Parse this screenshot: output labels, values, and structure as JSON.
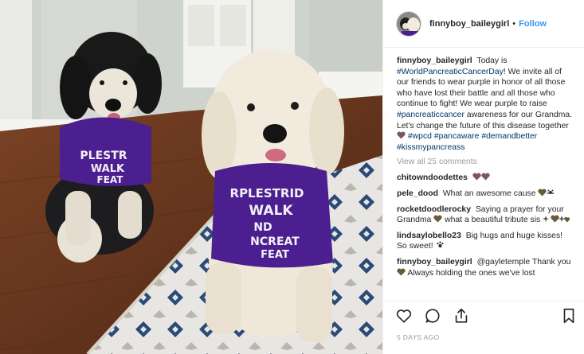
{
  "photo": {
    "description_icon": "photo-two-dogs",
    "left_shirt_lines": [
      "PLESTR",
      "WALK",
      "FEAT"
    ],
    "right_shirt_lines": [
      "RPLESTRID",
      "WALK",
      "ND",
      "NCREAT",
      "FEAT"
    ]
  },
  "header": {
    "username": "finnyboy_baileygirl",
    "separator": "•",
    "follow_label": "Follow"
  },
  "caption": {
    "username": "finnyboy_baileygirl",
    "text_1": "Today is",
    "tag_1": "#WorldPancreaticCancerDay",
    "text_2": "! We invite all of our friends to wear purple in honor of all those who have lost their battle and all those who continue to fight! We wear purple to raise",
    "tag_2": "#pancreaticcancer",
    "text_3": "awareness for our Grandma. Let's change the future of this disease together",
    "tag_3": "#wpcd",
    "tag_4": "#pancaware",
    "tag_5": "#demandbetter",
    "tag_6": "#kissmypancreass"
  },
  "view_all_comments": "View all 25 comments",
  "comments": [
    {
      "username": "chitowndoodettes",
      "text": ""
    },
    {
      "username": "pele_dood",
      "text": "What an awesome cause"
    },
    {
      "username": "rocketdoodlerocky",
      "text_1": "Saying a prayer for your Grandma",
      "text_2": "what a beautiful tribute sis"
    },
    {
      "username": "lindsaylobello23",
      "text": "Big hugs and huge kisses! So sweet!"
    },
    {
      "username": "finnyboy_baileygirl",
      "text_1": "@gayletemple Thank you",
      "text_2": "Always holding the ones we've lost"
    }
  ],
  "actions": {
    "like_icon": "heart-icon",
    "comment_icon": "comment-icon",
    "share_icon": "share-icon",
    "save_icon": "bookmark-icon"
  },
  "timestamp": "5 DAYS AGO",
  "colors": {
    "link_blue": "#3897f0",
    "hashtag": "#003569",
    "shirt_purple": "#4b1f8f",
    "muted": "#999999",
    "heart_emoji": "#7a5566"
  }
}
